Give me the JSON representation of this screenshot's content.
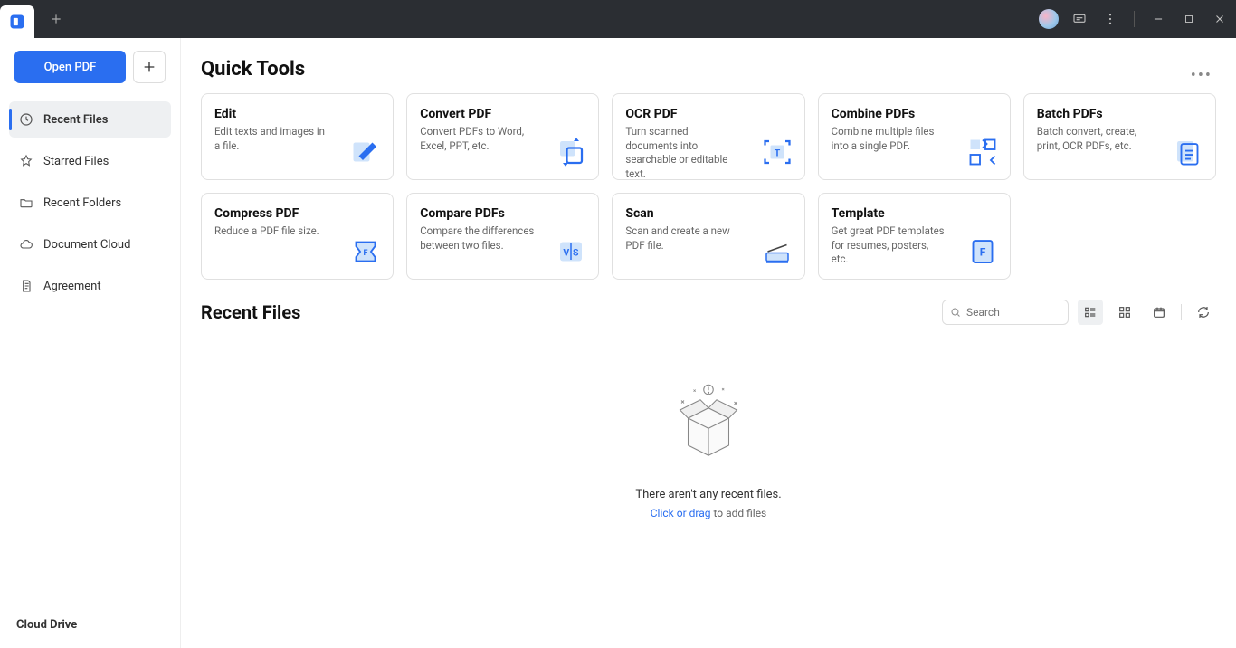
{
  "titlebar": {
    "new_tab_tooltip": "New Tab"
  },
  "sidebar": {
    "open_label": "Open PDF",
    "items": [
      {
        "label": "Recent Files",
        "icon": "clock"
      },
      {
        "label": "Starred Files",
        "icon": "star"
      },
      {
        "label": "Recent Folders",
        "icon": "folder"
      },
      {
        "label": "Document Cloud",
        "icon": "cloud"
      },
      {
        "label": "Agreement",
        "icon": "document"
      }
    ],
    "cloud_heading": "Cloud Drive"
  },
  "quick_tools": {
    "heading": "Quick Tools",
    "tools": [
      {
        "title": "Edit",
        "desc": "Edit texts and images in a file."
      },
      {
        "title": "Convert PDF",
        "desc": "Convert PDFs to Word, Excel, PPT, etc."
      },
      {
        "title": "OCR PDF",
        "desc": "Turn scanned documents into searchable or editable text."
      },
      {
        "title": "Combine PDFs",
        "desc": "Combine multiple files into a single PDF."
      },
      {
        "title": "Batch PDFs",
        "desc": "Batch convert, create, print, OCR PDFs, etc."
      },
      {
        "title": "Compress PDF",
        "desc": "Reduce a PDF file size."
      },
      {
        "title": "Compare PDFs",
        "desc": "Compare the differences between two files."
      },
      {
        "title": "Scan",
        "desc": "Scan and create a new PDF file."
      },
      {
        "title": "Template",
        "desc": "Get great PDF templates for resumes, posters, etc."
      }
    ]
  },
  "recent": {
    "heading": "Recent Files",
    "search_placeholder": "Search",
    "empty_text": "There aren't any recent files.",
    "empty_link": "Click or drag",
    "empty_suffix": " to add files"
  }
}
